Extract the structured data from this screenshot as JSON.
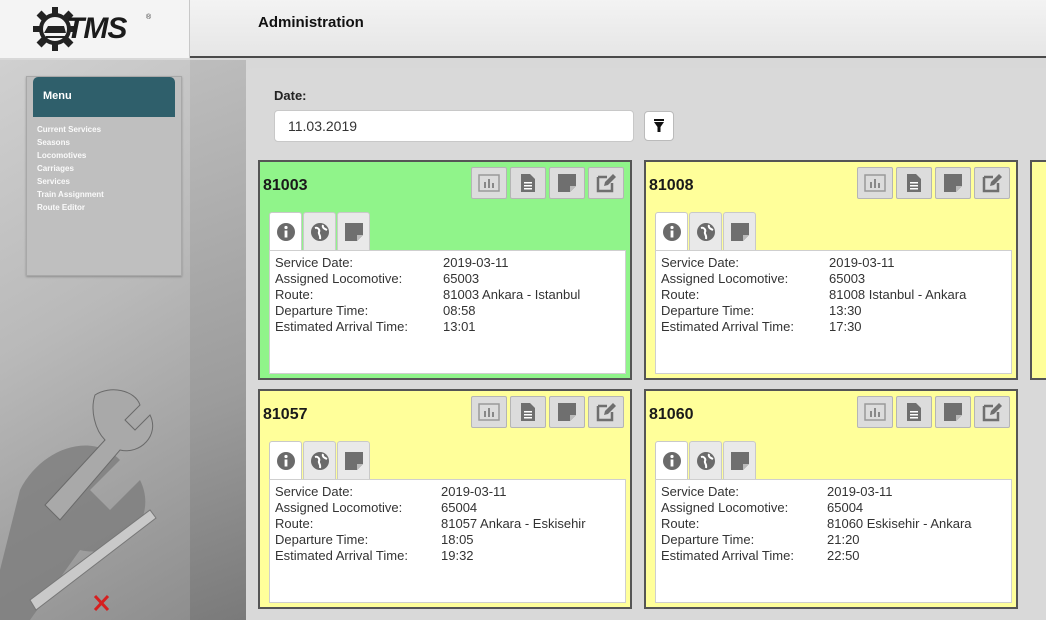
{
  "header": {
    "logo_text": "TMS",
    "logo_reg": "®",
    "title": "Administration"
  },
  "menu": {
    "title": "Menu",
    "items": [
      {
        "label": "Current Services"
      },
      {
        "label": "Seasons"
      },
      {
        "label": "Locomotives"
      },
      {
        "label": "Carriages"
      },
      {
        "label": "Services"
      },
      {
        "label": "Train Assignment"
      },
      {
        "label": "Route Editor"
      }
    ]
  },
  "filter": {
    "date_label": "Date:",
    "date_value": "11.03.2019",
    "filter_icon": "funnel-icon"
  },
  "field_labels": {
    "service_date": "Service Date:",
    "locomotive": "Assigned Locomotive:",
    "route": "Route:",
    "departure": "Departure Time:",
    "arrival": "Estimated Arrival Time:"
  },
  "cards": [
    {
      "id": "81003",
      "status_color": "#90f48a",
      "service_date": "2019-03-11",
      "locomotive": "65003",
      "route": "81003 Ankara - Istanbul",
      "departure": "08:58",
      "arrival": "13:01"
    },
    {
      "id": "81008",
      "status_color": "#ffff9a",
      "service_date": "2019-03-11",
      "locomotive": "65003",
      "route": "81008 Istanbul - Ankara",
      "departure": "13:30",
      "arrival": "17:30"
    },
    {
      "id": "81057",
      "status_color": "#ffff9a",
      "service_date": "2019-03-11",
      "locomotive": "65004",
      "route": "81057 Ankara - Eskisehir",
      "departure": "18:05",
      "arrival": "19:32"
    },
    {
      "id": "81060",
      "status_color": "#ffff9a",
      "service_date": "2019-03-11",
      "locomotive": "65004",
      "route": "81060 Eskisehir - Ankara",
      "departure": "21:20",
      "arrival": "22:50"
    }
  ],
  "card_action_icons": [
    "chart-icon",
    "document-icon",
    "note-icon",
    "edit-icon"
  ],
  "card_tab_icons": [
    "info-icon",
    "globe-icon",
    "note-icon"
  ],
  "colors": {
    "menu_header": "#2f5f6b",
    "active_card": "#90f48a",
    "pending_card": "#ffff9a"
  }
}
